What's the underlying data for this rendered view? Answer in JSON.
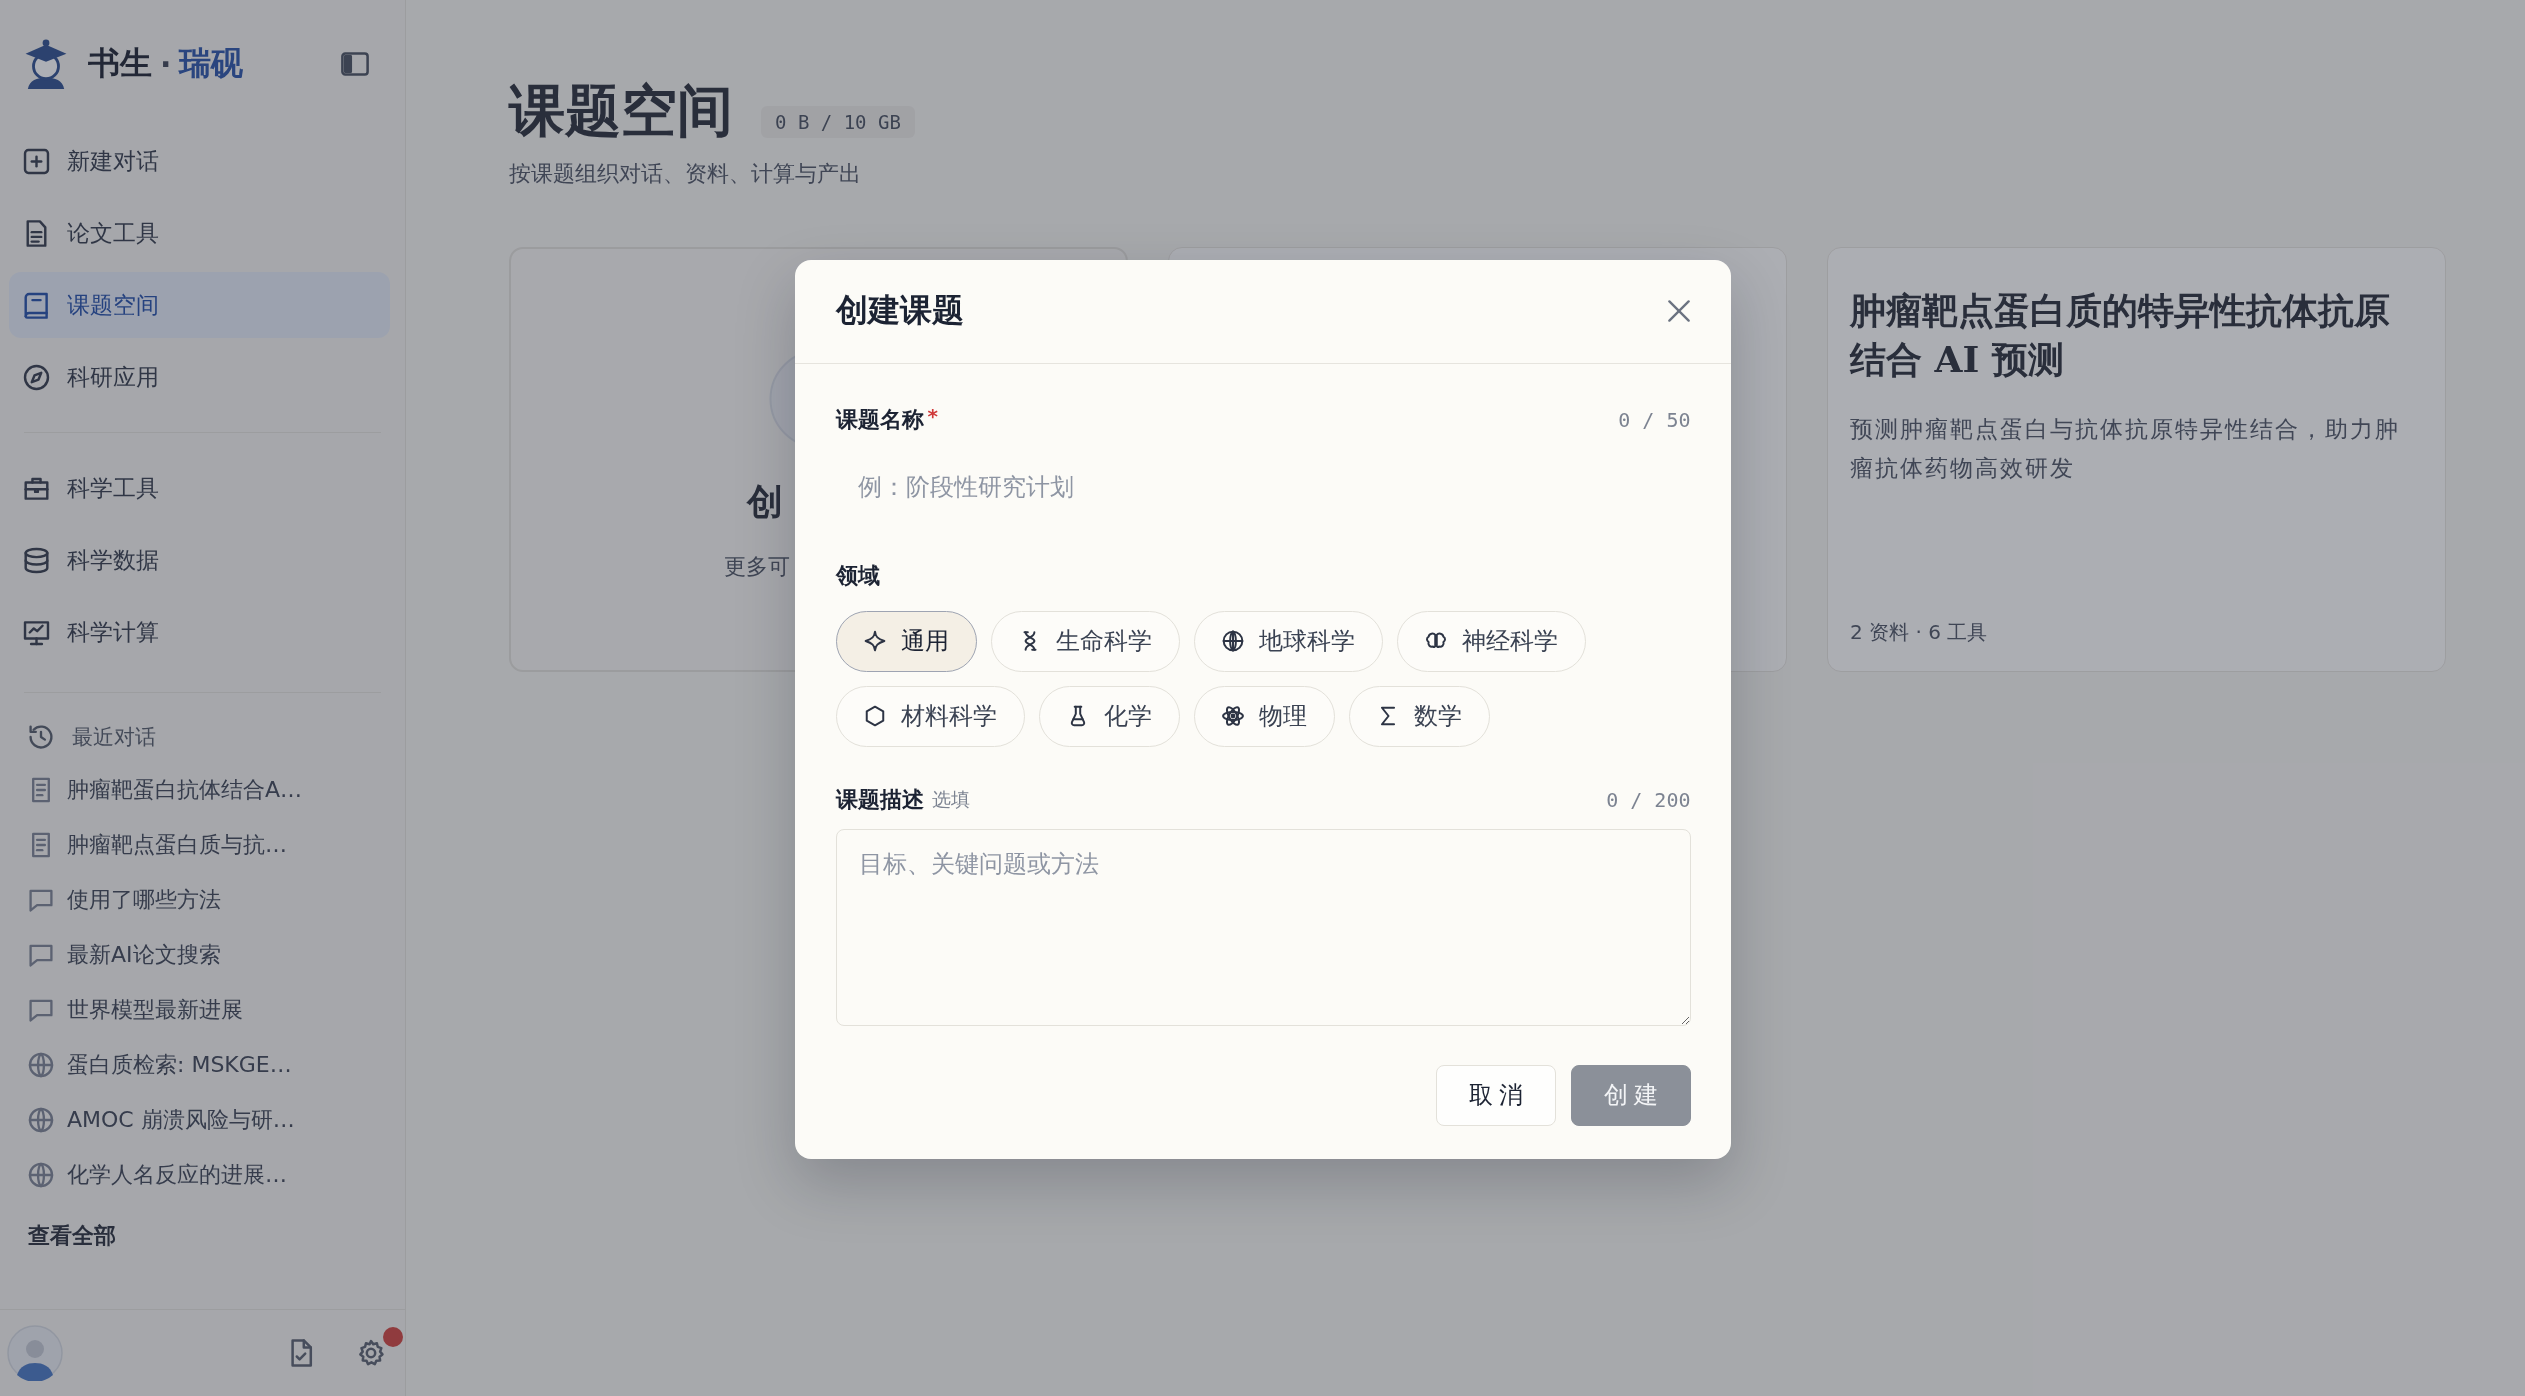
{
  "sidebar": {
    "brand": {
      "name": "书生",
      "dot": "·",
      "suffix": "瑞砚"
    },
    "nav_main": [
      {
        "label": "新建对话",
        "selected": false
      },
      {
        "label": "论文工具",
        "selected": false
      },
      {
        "label": "课题空间",
        "selected": true
      },
      {
        "label": "科研应用",
        "selected": false
      }
    ],
    "nav_science": [
      {
        "label": "科学工具",
        "selected": false
      },
      {
        "label": "科学数据",
        "selected": false
      },
      {
        "label": "科学计算",
        "selected": false
      }
    ],
    "recent": {
      "title": "最近对话",
      "items": [
        {
          "kind": "document",
          "label": "肿瘤靶蛋白抗体结合A…"
        },
        {
          "kind": "document",
          "label": "肿瘤靶点蛋白质与抗…"
        },
        {
          "kind": "chat",
          "label": "使用了哪些方法"
        },
        {
          "kind": "chat",
          "label": "最新AI论文搜索"
        },
        {
          "kind": "chat",
          "label": "世界模型最新进展"
        },
        {
          "kind": "web",
          "label": "蛋白质检索: MSKGE…"
        },
        {
          "kind": "web",
          "label": "AMOC 崩溃风险与研…"
        },
        {
          "kind": "web",
          "label": "化学人名反应的进展…"
        }
      ],
      "view_all": "查看全部"
    }
  },
  "main": {
    "header": {
      "title": "课题空间",
      "quota": "0 B / 10 GB",
      "subtitle": "按课题组织对话、资料、计算与产出"
    },
    "cards": [
      {
        "kind": "create",
        "title": "创",
        "description": "更多可"
      },
      {
        "kind": "topic"
      },
      {
        "kind": "topic",
        "title": "肿瘤靶点蛋白质的特异性抗体抗原结合 AI 预测",
        "description": "预测肿瘤靶点蛋白与抗体抗原特异性结合，助力肿瘤抗体药物高效研发",
        "meta": "2 资料 · 6 工具"
      }
    ]
  },
  "modal": {
    "title": "创建课题",
    "name_field": {
      "label": "课题名称",
      "required_mark": "*",
      "counter": "0 / 50",
      "placeholder": "例：阶段性研究计划"
    },
    "domain": {
      "label": "领域",
      "options": [
        {
          "label": "通用",
          "selected": true
        },
        {
          "label": "生命科学",
          "selected": false
        },
        {
          "label": "地球科学",
          "selected": false
        },
        {
          "label": "神经科学",
          "selected": false
        },
        {
          "label": "材料科学",
          "selected": false
        },
        {
          "label": "化学",
          "selected": false
        },
        {
          "label": "物理",
          "selected": false
        },
        {
          "label": "数学",
          "selected": false
        }
      ]
    },
    "description_field": {
      "label": "课题描述",
      "hint": "选填",
      "counter": "0 / 200",
      "placeholder": "目标、关键问题或方法"
    },
    "buttons": [
      {
        "kind": "secondary",
        "label": "取消",
        "disabled": false
      },
      {
        "kind": "primary",
        "label": "创建",
        "disabled": true
      }
    ]
  }
}
